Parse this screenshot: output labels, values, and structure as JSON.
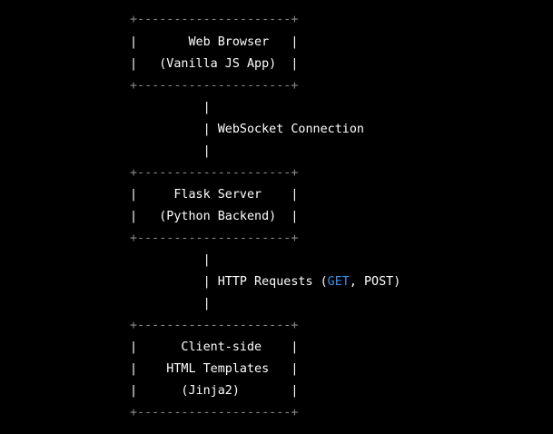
{
  "diagram": {
    "lines": [
      "+---------------------+",
      "|       Web Browser   |",
      "|   (Vanilla JS App)  |",
      "+---------------------+",
      "          |",
      "          | WebSocket Connection",
      "          |",
      "+---------------------+",
      "|     Flask Server    |",
      "|   (Python Backend)  |",
      "+---------------------+",
      "          |",
      "          | HTTP Requests (",
      "          |",
      "+---------------------+",
      "|      Client-side    |",
      "|    HTML Templates   |",
      "|      (Jinja2)       |",
      "+---------------------+"
    ],
    "http_methods": {
      "get": "GET",
      "separator": ", ",
      "post": "POST",
      "close": ")"
    }
  },
  "colors": {
    "background": "#000000",
    "text": "#ffffff",
    "border": "#8a8a8a",
    "keyword": "#3b8eea"
  }
}
